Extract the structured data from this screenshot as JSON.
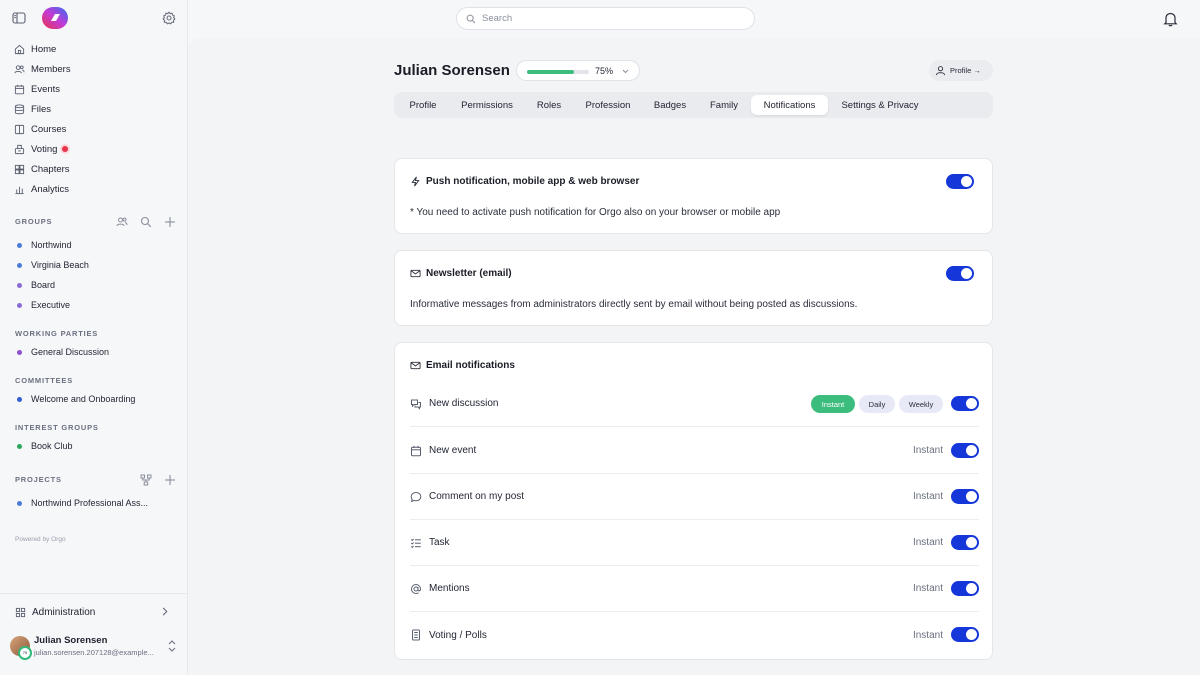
{
  "search": {
    "placeholder": "Search"
  },
  "sidebar": {
    "nav": [
      {
        "label": "Home",
        "icon": "home-icon"
      },
      {
        "label": "Members",
        "icon": "members-icon"
      },
      {
        "label": "Events",
        "icon": "calendar-icon"
      },
      {
        "label": "Files",
        "icon": "files-icon"
      },
      {
        "label": "Courses",
        "icon": "book-icon"
      },
      {
        "label": "Voting",
        "icon": "ballot-icon"
      },
      {
        "label": "Chapters",
        "icon": "chapters-icon"
      },
      {
        "label": "Analytics",
        "icon": "analytics-icon"
      }
    ],
    "groups_label": "GROUPS",
    "groups": [
      {
        "label": "Northwind",
        "color": "#4a7bd8"
      },
      {
        "label": "Virginia Beach",
        "color": "#4a7bd8"
      },
      {
        "label": "Board",
        "color": "#8b6bd6"
      },
      {
        "label": "Executive",
        "color": "#8b6bd6"
      }
    ],
    "working_label": "WORKING PARTIES",
    "working": [
      {
        "label": "General Discussion",
        "color": "#8b4fd0"
      }
    ],
    "committees_label": "COMMITTEES",
    "committees": [
      {
        "label": "Welcome and Onboarding",
        "color": "#2f5fd0"
      }
    ],
    "interest_label": "INTEREST GROUPS",
    "interest": [
      {
        "label": "Book Club",
        "color": "#2aa75a"
      }
    ],
    "projects_label": "PROJECTS",
    "projects": [
      {
        "label": "Northwind Professional Ass...",
        "color": "#4a7bd8"
      }
    ],
    "powered": "Powered by Orgo",
    "admin_label": "Administration",
    "user": {
      "name": "Julian Sorensen",
      "email": "julian.sorensen.207128@example...",
      "badge": "75"
    }
  },
  "header": {
    "title": "Julian Sorensen",
    "progress_label": "75%",
    "progress_value": 0.75,
    "profile_button": "Profile →"
  },
  "tabs": [
    "Profile",
    "Permissions",
    "Roles",
    "Profession",
    "Badges",
    "Family",
    "Notifications",
    "Settings & Privacy"
  ],
  "active_tab": "Notifications",
  "push": {
    "title": "Push notification, mobile app & web browser",
    "desc": "* You need to activate push notification for Orgo also on your browser or mobile app"
  },
  "newsletter": {
    "title": "Newsletter (email)",
    "desc": "Informative messages from administrators directly sent by email without being posted as discussions."
  },
  "email": {
    "title": "Email notifications",
    "freq_options": [
      "Instant",
      "Daily",
      "Weekly"
    ],
    "rows": [
      {
        "label": "New discussion",
        "icon": "chat-icon",
        "freq": ""
      },
      {
        "label": "New event",
        "icon": "calendar-icon",
        "freq": "Instant"
      },
      {
        "label": "Comment on my post",
        "icon": "comment-icon",
        "freq": "Instant"
      },
      {
        "label": "Task",
        "icon": "task-list-icon",
        "freq": "Instant"
      },
      {
        "label": "Mentions",
        "icon": "at-icon",
        "freq": "Instant"
      },
      {
        "label": "Voting / Polls",
        "icon": "poll-icon",
        "freq": "Instant"
      }
    ]
  },
  "colors": {
    "accent": "#1536d8",
    "success": "#3dbd7d",
    "alert": "#e8344b"
  }
}
